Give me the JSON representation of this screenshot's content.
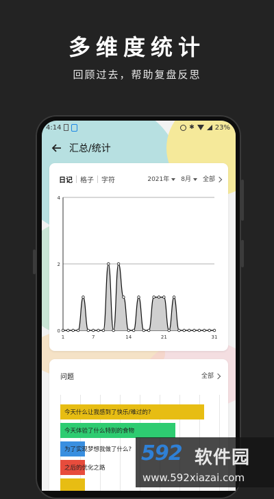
{
  "hero": {
    "title": "多维度统计",
    "subtitle": "回顾过去，帮助复盘反思"
  },
  "statusbar": {
    "time": "4:14",
    "battery": "23%"
  },
  "nav": {
    "title": "汇总/统计"
  },
  "stats_card": {
    "tabs": [
      "日记",
      "格子",
      "字符"
    ],
    "year": "2021年",
    "month": "8月",
    "all": "全部"
  },
  "chart_data": {
    "type": "area",
    "x": [
      1,
      2,
      3,
      4,
      5,
      6,
      7,
      8,
      9,
      10,
      11,
      12,
      13,
      14,
      15,
      16,
      17,
      18,
      19,
      20,
      21,
      22,
      23,
      24,
      25,
      26,
      27,
      28,
      29,
      30,
      31
    ],
    "values": [
      0,
      0,
      0,
      0,
      1,
      0,
      0,
      0,
      0,
      2,
      0,
      2,
      1,
      0,
      0,
      1,
      0,
      0,
      1,
      1,
      1,
      0,
      1,
      0,
      0,
      0,
      0,
      0,
      0,
      0,
      0
    ],
    "xticks": [
      "1",
      "7",
      "14",
      "21",
      "31"
    ],
    "yticks": [
      "0",
      "2",
      "4"
    ],
    "ylim": [
      0,
      4
    ],
    "grid": true
  },
  "questions": {
    "title": "问题",
    "all": "全部",
    "items": [
      {
        "label": "今天什么让我感到了快乐/难过的?",
        "color": "#e7bd13",
        "value": 1.0
      },
      {
        "label": "今天体验了什么特别的食物",
        "color": "#2ecc71",
        "value": 0.8
      },
      {
        "label": "为了实现梦想我做了什么?",
        "color": "#3a8fe0",
        "value": 0.15
      },
      {
        "label": "之后的优化之路",
        "color": "#e74c3c",
        "value": 0.15
      },
      {
        "label": "",
        "color": "#e7bd13",
        "value": 0.15
      }
    ]
  },
  "watermark": {
    "logo": "592",
    "name": "软件园",
    "url": "www.592xiazai.com"
  }
}
